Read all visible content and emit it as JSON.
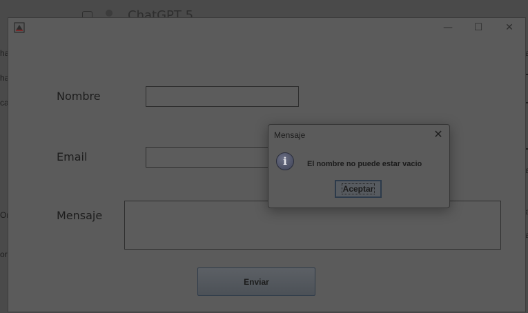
{
  "background_app": {
    "title": "ChatGPT 5",
    "fragments": [
      "ha",
      "ha",
      "ca",
      "Ori",
      "orc"
    ],
    "right_fragments": [
      "a",
      "a",
      "a",
      "a"
    ]
  },
  "window": {
    "controls": {
      "minimize": "—",
      "maximize": "☐",
      "close": "✕"
    },
    "form": {
      "name_label": "Nombre",
      "name_value": "",
      "email_label": "Email",
      "email_value": "",
      "message_label": "Mensaje",
      "message_value": "",
      "send_label": "Enviar"
    }
  },
  "dialog": {
    "title": "Mensaje",
    "close": "✕",
    "icon": "info-icon",
    "icon_glyph": "i",
    "message": "El nombre no puede estar vacio",
    "ok_label": "Aceptar"
  }
}
